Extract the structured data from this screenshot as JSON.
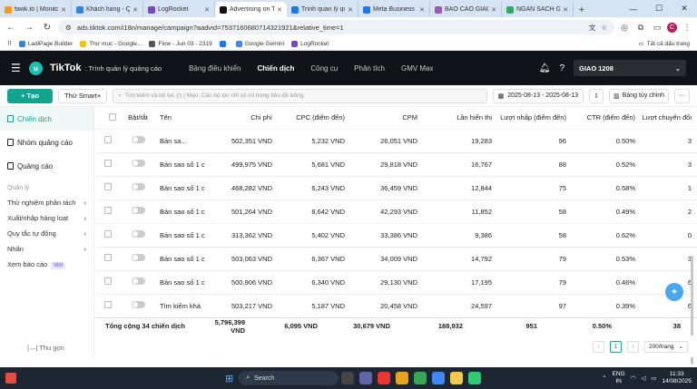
{
  "browser": {
    "tabs": [
      {
        "title": "fawk.to | Monitor...",
        "color": "#f39c12"
      },
      {
        "title": "Khách hàng - Qu...",
        "color": "#2e86de"
      },
      {
        "title": "LogRocket",
        "color": "#764abc"
      },
      {
        "title": "Advertising on T...",
        "color": "#111111",
        "active": true
      },
      {
        "title": "Trình quản lý qu...",
        "color": "#1877f2"
      },
      {
        "title": "Meta Business S...",
        "color": "#1877f2"
      },
      {
        "title": "BÁO CÁO GIAO...",
        "color": "#9b59b6"
      },
      {
        "title": "NGÂN SÁCH GI...",
        "color": "#27ae60"
      }
    ],
    "newtab": "+",
    "url": "ads.tiktok.com/i18n/manage/campaign?aadvid=7537160680714321921&relative_time=1",
    "bookmarks": [
      {
        "label": "LadiPage Builder",
        "color": "#2e86de"
      },
      {
        "label": "Thư mục - Google...",
        "color": "#f1c40f"
      },
      {
        "label": "Flow - Jun 03 - 2319",
        "color": "#555555"
      },
      {
        "label": "",
        "color": "#1877f2"
      },
      {
        "label": "Google Gemini",
        "color": "#4285f4"
      },
      {
        "label": "LogRocket",
        "color": "#764abc"
      }
    ],
    "bookmarks_all": "Tất cả dấu trang",
    "profile_letter": "C"
  },
  "tiktok": {
    "brand": "TikTok",
    "brand_sub": ": Trình quản lý quảng cáo",
    "nav": [
      "Bảng điều khiển",
      "Chiến dịch",
      "Công cụ",
      "Phân tích",
      "GMV Max"
    ],
    "active_nav": 1,
    "account": "GIAO 1208"
  },
  "toolbar": {
    "create": "+ Tạo",
    "smart": "Thử Smart+",
    "search_placeholder": "Tìm kiếm và bộ lọc (/) | Mẹo: Các bộ lọc chỉ số có trong tiêu đề bảng",
    "date_range": "2025-08-13 - 2025-08-13",
    "custom_table": "Bảng tùy chỉnh",
    "more": "···"
  },
  "sidebar": {
    "items": [
      "Chiến dịch",
      "Nhóm quảng cáo",
      "Quảng cáo"
    ],
    "section": "Quản lý",
    "links": [
      {
        "label": "Thử nghiệm phân tách",
        "arrow": "›"
      },
      {
        "label": "Xuất/nhập hàng loạt",
        "arrow": "›"
      },
      {
        "label": "Quy tắc tự động",
        "arrow": "›"
      },
      {
        "label": "Nhãn",
        "arrow": "›"
      },
      {
        "label": "Xem báo cáo",
        "arrow": "",
        "badge": "Mới"
      }
    ],
    "collapse": "|↔| Thu gọn"
  },
  "table": {
    "headers": [
      "Bật/tắt",
      "Tên",
      "Chi phí",
      "CPC (điểm đến)",
      "CPM",
      "Lần hiển thị",
      "Lượt nhấp (điểm đến)",
      "CTR (điểm đến)",
      "Lượt chuyển đổi"
    ],
    "rows": [
      {
        "name": "Bản sa...",
        "cost": "502,351 VND",
        "cpc": "5,232 VND",
        "cpm": "26,051 VND",
        "impr": "19,283",
        "clicks": "96",
        "ctr": "0.50%",
        "conv": "3"
      },
      {
        "name": "Bản sao số 1 c",
        "cost": "499,975 VND",
        "cpc": "5,681 VND",
        "cpm": "29,818 VND",
        "impr": "16,767",
        "clicks": "88",
        "ctr": "0.52%",
        "conv": "3"
      },
      {
        "name": "Bản sao số 1 c",
        "cost": "468,282 VND",
        "cpc": "6,243 VND",
        "cpm": "36,459 VND",
        "impr": "12,844",
        "clicks": "75",
        "ctr": "0.58%",
        "conv": "1"
      },
      {
        "name": "Bản sao số 1 c",
        "cost": "501,264 VND",
        "cpc": "8,642 VND",
        "cpm": "42,293 VND",
        "impr": "11,852",
        "clicks": "58",
        "ctr": "0.49%",
        "conv": "2"
      },
      {
        "name": "Bản sao số 1 c",
        "cost": "313,362 VND",
        "cpc": "5,402 VND",
        "cpm": "33,386 VND",
        "impr": "9,386",
        "clicks": "58",
        "ctr": "0.62%",
        "conv": "0"
      },
      {
        "name": "Bản sao số 1 c",
        "cost": "503,063 VND",
        "cpc": "6,367 VND",
        "cpm": "34,009 VND",
        "impr": "14,792",
        "clicks": "79",
        "ctr": "0.53%",
        "conv": "3"
      },
      {
        "name": "Bản sao số 1 c",
        "cost": "500,906 VND",
        "cpc": "6,340 VND",
        "cpm": "29,130 VND",
        "impr": "17,195",
        "clicks": "79",
        "ctr": "0.46%",
        "conv": "6"
      },
      {
        "name": "Tìm kiếm khá",
        "cost": "503,217 VND",
        "cpc": "5,187 VND",
        "cpm": "20,458 VND",
        "impr": "24,597",
        "clicks": "97",
        "ctr": "0.39%",
        "conv": "6"
      }
    ],
    "total": {
      "label": "Tổng cộng 34 chiến dịch",
      "cost": "5,796,399 VND",
      "cpc": "6,095 VND",
      "cpm": "30,679 VND",
      "impr": "188,932",
      "clicks": "951",
      "ctr": "0.50%",
      "conv": "38"
    }
  },
  "pager": {
    "prev": "‹",
    "page": "1",
    "next": "›",
    "per_page": "200/trang"
  },
  "taskbar": {
    "search": "Search",
    "lang": "ENG",
    "lang2": "IN",
    "time": "11:33",
    "date": "14/08/2025"
  }
}
